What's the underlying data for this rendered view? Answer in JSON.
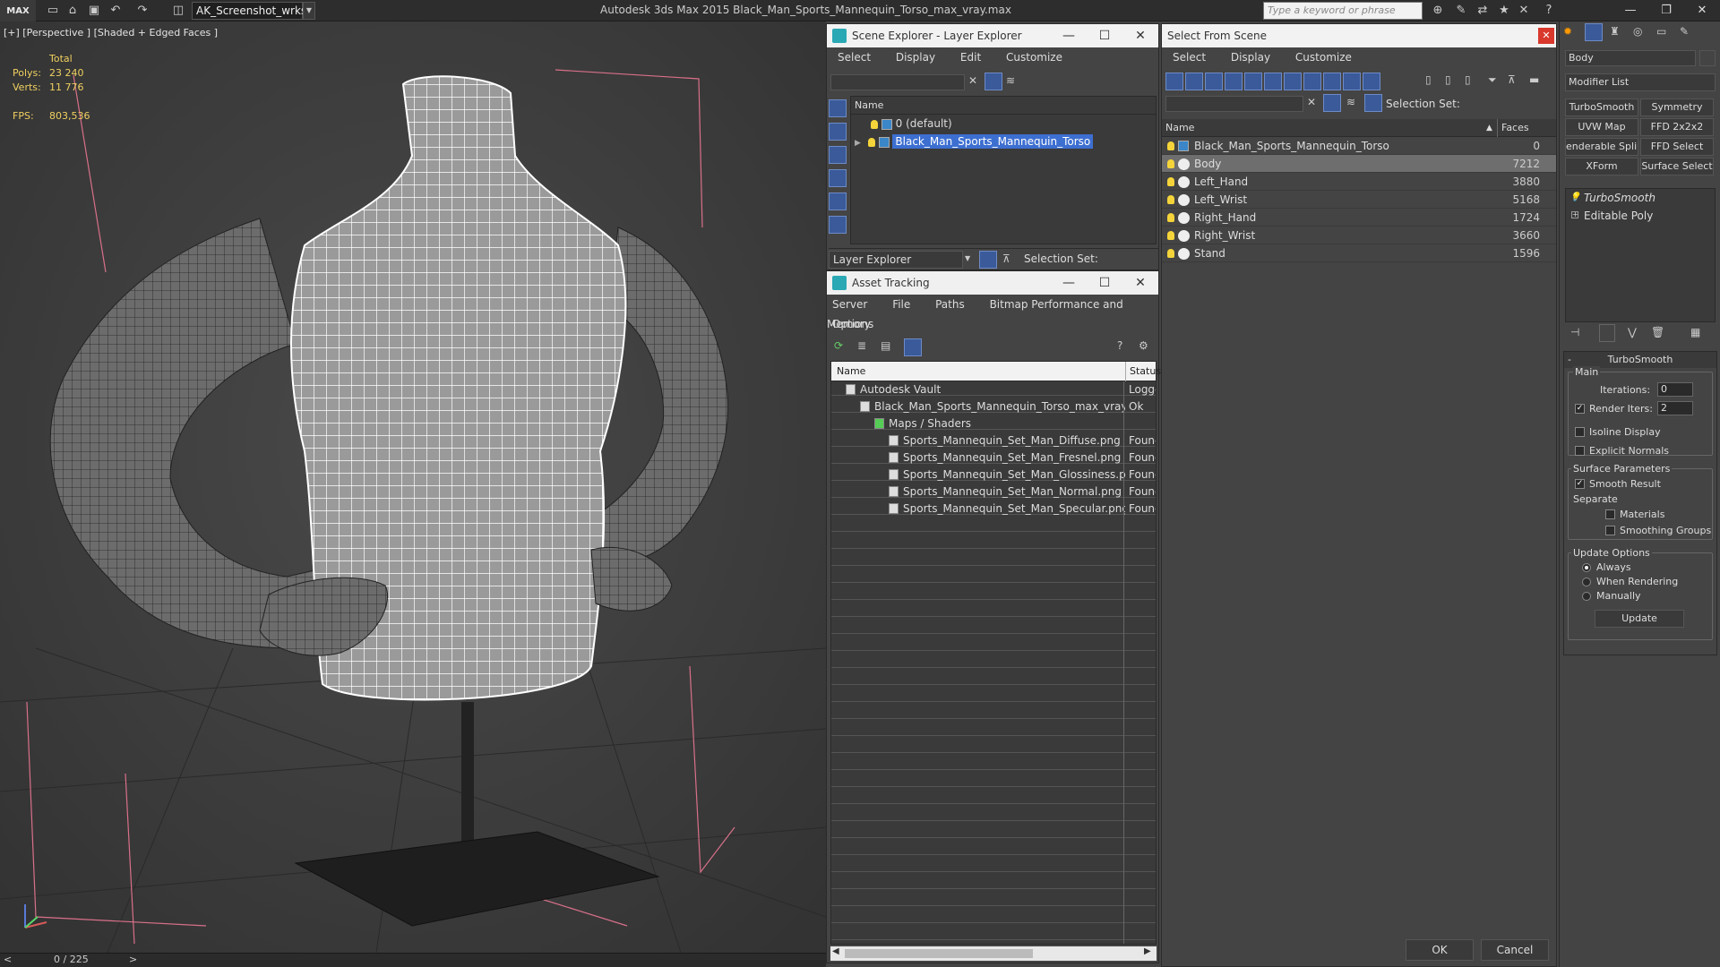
{
  "app": {
    "logo": "MAX",
    "workspace": "AK_Screenshot_wrksp",
    "title": "Autodesk 3ds Max  2015     Black_Man_Sports_Mannequin_Torso_max_vray.max",
    "search_placeholder": "Type a keyword or phrase"
  },
  "viewport": {
    "label": "[+] [Perspective ] [Shaded + Edged Faces ]",
    "total_label": "Total",
    "polys_label": "Polys:",
    "polys_value": "23 240",
    "verts_label": "Verts:",
    "verts_value": "11 776",
    "fps_label": "FPS:",
    "fps_value": "803,536",
    "timeline": "0 / 225"
  },
  "scene_explorer": {
    "title": "Scene Explorer - Layer Explorer",
    "menu": [
      "Select",
      "Display",
      "Edit",
      "Customize"
    ],
    "col_name": "Name",
    "layers": [
      {
        "label": "0 (default)",
        "selected": false
      },
      {
        "label": "Black_Man_Sports_Mannequin_Torso",
        "selected": true
      }
    ],
    "footer_label": "Layer Explorer",
    "selection_set_label": "Selection Set:"
  },
  "asset_tracking": {
    "title": "Asset Tracking",
    "menu": [
      "Server",
      "File",
      "Paths",
      "Bitmap Performance and Memory"
    ],
    "menu2": [
      "Options"
    ],
    "col_name": "Name",
    "col_status": "Status",
    "rows": [
      {
        "name": "Autodesk Vault",
        "status": "Logge",
        "indent": 1
      },
      {
        "name": "Black_Man_Sports_Mannequin_Torso_max_vray....",
        "status": "Ok",
        "indent": 2
      },
      {
        "name": "Maps / Shaders",
        "status": "",
        "indent": 3
      },
      {
        "name": "Sports_Mannequin_Set_Man_Diffuse.png",
        "status": "Founc",
        "indent": 4
      },
      {
        "name": "Sports_Mannequin_Set_Man_Fresnel.png",
        "status": "Founc",
        "indent": 4
      },
      {
        "name": "Sports_Mannequin_Set_Man_Glossiness.png",
        "status": "Founc",
        "indent": 4
      },
      {
        "name": "Sports_Mannequin_Set_Man_Normal.png",
        "status": "Founc",
        "indent": 4
      },
      {
        "name": "Sports_Mannequin_Set_Man_Specular.png",
        "status": "Founc",
        "indent": 4
      }
    ]
  },
  "select_from_scene": {
    "title": "Select From Scene",
    "menu": [
      "Select",
      "Display",
      "Customize"
    ],
    "selection_set_label": "Selection Set:",
    "col_name": "Name",
    "col_faces": "Faces",
    "rows": [
      {
        "name": "Black_Man_Sports_Mannequin_Torso",
        "faces": "0",
        "selected": false
      },
      {
        "name": "Body",
        "faces": "7212",
        "selected": true
      },
      {
        "name": "Left_Hand",
        "faces": "3880",
        "selected": false
      },
      {
        "name": "Left_Wrist",
        "faces": "5168",
        "selected": false
      },
      {
        "name": "Right_Hand",
        "faces": "1724",
        "selected": false
      },
      {
        "name": "Right_Wrist",
        "faces": "3660",
        "selected": false
      },
      {
        "name": "Stand",
        "faces": "1596",
        "selected": false
      }
    ],
    "ok": "OK",
    "cancel": "Cancel"
  },
  "command_panel": {
    "object_name": "Body",
    "modifier_list": "Modifier List",
    "buttons": [
      "TurboSmooth",
      "Symmetry",
      "UVW Map",
      "FFD 2x2x2",
      "enderable Splir",
      "FFD Select",
      "XForm",
      "Surface Select"
    ],
    "stack": [
      "TurboSmooth",
      "Editable Poly"
    ],
    "rollout_title": "TurboSmooth",
    "main_label": "Main",
    "iterations_label": "Iterations:",
    "iterations_value": "0",
    "render_iters_label": "Render Iters:",
    "render_iters_value": "2",
    "isoline_label": "Isoline Display",
    "explicit_normals_label": "Explicit Normals",
    "surface_params_label": "Surface Parameters",
    "smooth_result_label": "Smooth Result",
    "separate_label": "Separate",
    "materials_label": "Materials",
    "smoothing_groups_label": "Smoothing Groups",
    "update_options_label": "Update Options",
    "always_label": "Always",
    "when_rendering_label": "When Rendering",
    "manually_label": "Manually",
    "update_button": "Update"
  },
  "colors": {
    "selection": "#3d6fd1",
    "accent_teal": "#2aa9b5",
    "stats_yellow": "#f0d060"
  }
}
